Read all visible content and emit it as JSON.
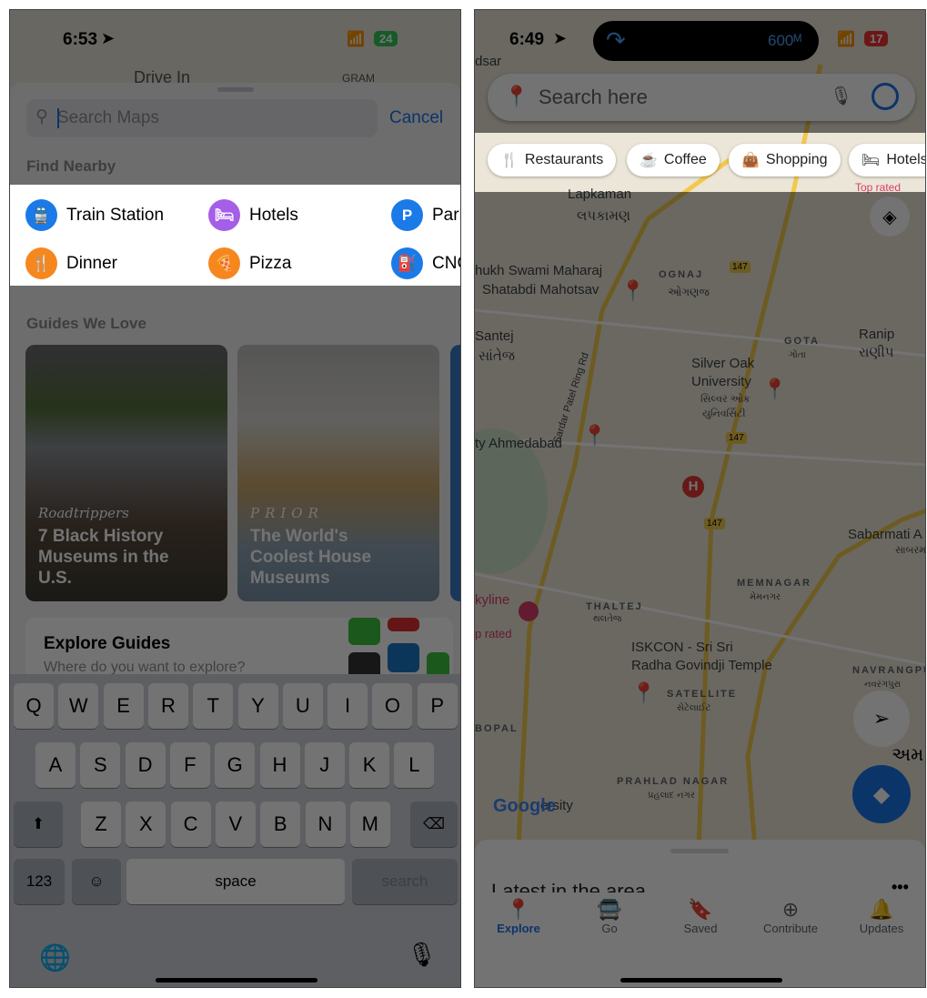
{
  "left": {
    "status": {
      "time": "6:53",
      "battery": "24"
    },
    "map_behind": {
      "label1": "Drive In",
      "label2": "GRAM"
    },
    "search": {
      "placeholder": "Search Maps",
      "cancel": "Cancel"
    },
    "find_nearby": {
      "title": "Find Nearby",
      "items": [
        {
          "label": "Train Station",
          "icon": "train-icon",
          "color": "#1a7ae8"
        },
        {
          "label": "Hotels",
          "icon": "bed-icon",
          "color": "#a55ee8"
        },
        {
          "label": "Parking",
          "icon": "parking-icon",
          "color": "#1a7ae8",
          "glyph": "P"
        },
        {
          "label": "Dinner",
          "icon": "fork-knife-icon",
          "color": "#f6871f"
        },
        {
          "label": "Pizza",
          "icon": "pizza-icon",
          "color": "#f6871f"
        },
        {
          "label": "CNG",
          "icon": "fuel-icon",
          "color": "#1a7ae8"
        }
      ]
    },
    "guides": {
      "title": "Guides We Love",
      "cards": [
        {
          "source": "Roadtrippers",
          "title": "7 Black History Museums in the U.S."
        },
        {
          "source": "PRIOR",
          "title": "The World's Coolest House Museums"
        }
      ],
      "explore_title": "Explore Guides",
      "explore_sub": "Where do you want to explore?"
    },
    "keyboard": {
      "rows": [
        [
          "Q",
          "W",
          "E",
          "R",
          "T",
          "Y",
          "U",
          "I",
          "O",
          "P"
        ],
        [
          "A",
          "S",
          "D",
          "F",
          "G",
          "H",
          "J",
          "K",
          "L"
        ],
        [
          "Z",
          "X",
          "C",
          "V",
          "B",
          "N",
          "M"
        ]
      ],
      "numbers": "123",
      "space": "space",
      "action": "search"
    }
  },
  "right": {
    "status": {
      "time": "6:49",
      "island_distance": "600ᴹ",
      "battery": "17"
    },
    "search": {
      "placeholder": "Search here"
    },
    "chips": [
      {
        "label": "Restaurants",
        "icon": "fork-knife-icon"
      },
      {
        "label": "Coffee",
        "icon": "coffee-icon"
      },
      {
        "label": "Shopping",
        "icon": "shopping-bag-icon"
      },
      {
        "label": "Hotels",
        "icon": "bed-icon"
      }
    ],
    "map": {
      "labels": {
        "adsar": "dsar",
        "lapkaman": "Lapkaman",
        "lapkaman_gu": "લપકામણ",
        "swami": "hukh Swami Maharaj",
        "shatabdi": "Shatabdi Mahotsav",
        "ognaj": "OGNAJ",
        "ognaj_gu": "ઓગણજ",
        "santej": "Santej",
        "santej_gu": "સાંતેજ",
        "gota": "GOTA",
        "gota_gu": "ગોતા",
        "ranip": "Ranip",
        "ranip_gu": "રાણીપ",
        "silver1": "Silver Oak",
        "silver2": "University",
        "silver_gu1": "સિલ્વર ઓક",
        "silver_gu2": "યુનિવર્સિટી",
        "ahmedabad": "ty Ahmedabad",
        "sabarmati": "Sabarmati A",
        "sabarmati_gu": "સાબરમ",
        "skyline": "kyline",
        "top_rated": "p rated",
        "top_rated2": "Top rated",
        "thaltej": "THALTEJ",
        "thaltej_gu": "થલતેજ",
        "memnagar": "MEMNAGAR",
        "memnagar_gu": "મેમનગર",
        "iskcon1": "ISKCON - Sri Sri",
        "iskcon2": "Radha Govindji Temple",
        "satellite": "SATELLITE",
        "satellite_gu": "સેટેલાઈટ",
        "navrangpura": "NAVRANGPUR",
        "navrangpura_gu": "નવરંગપુરા",
        "bopal": "BOPAL",
        "prahlad": "PRAHLAD NAGAR",
        "prahlad_gu": "પ્રહલાદ નગર",
        "versity": "ersity",
        "amd_gu": "અમ",
        "ring_rd": "Sardar Patel Ring Rd",
        "hwy": "147",
        "google": "Google"
      }
    },
    "sheet": {
      "title": "Latest in the area"
    },
    "nav": [
      {
        "label": "Explore",
        "icon": "pin-icon",
        "active": true
      },
      {
        "label": "Go",
        "icon": "commute-icon"
      },
      {
        "label": "Saved",
        "icon": "bookmark-icon"
      },
      {
        "label": "Contribute",
        "icon": "add-circle-icon"
      },
      {
        "label": "Updates",
        "icon": "bell-icon"
      }
    ],
    "accent": "#1a73e8"
  }
}
